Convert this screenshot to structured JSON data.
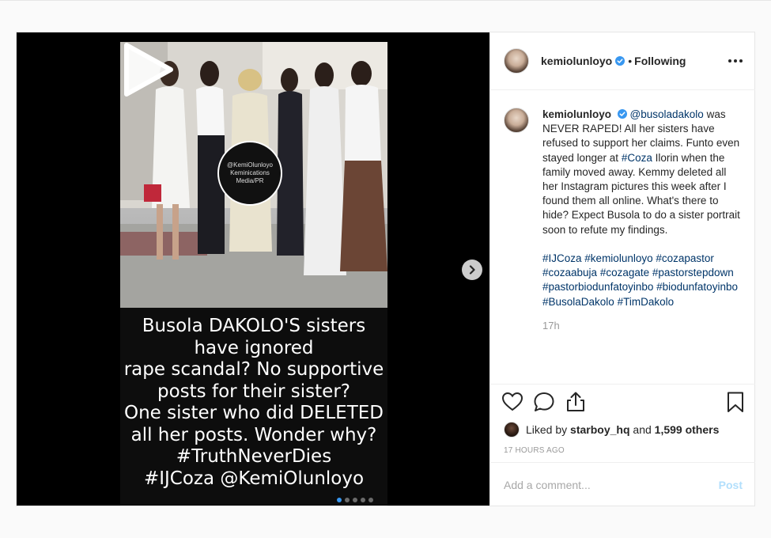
{
  "post": {
    "username": "kemiolunloyo",
    "follow_status": "Following",
    "bullet": "•",
    "image": {
      "watermark_lines": [
        "@KemiOlunloyo",
        "Keminications",
        "Media/PR"
      ],
      "caption_lines": [
        "Busola DAKOLO'S sisters",
        "have ignored",
        "rape scandal? No supportive",
        "posts for their sister?",
        "One sister who did DELETED",
        "all her posts. Wonder why?",
        "#TruthNeverDies",
        "#IJCoza @KemiOlunloyo"
      ],
      "carousel_count": 5,
      "carousel_active": 1
    },
    "caption": {
      "username": "kemiolunloyo",
      "mention": "@busoladakolo",
      "text1": " was NEVER RAPED! All her sisters have refused to support her claims. Funto even stayed longer at ",
      "tag_coza": "#Coza",
      "text2": " Ilorin when the family moved away. Kemmy deleted all her Instagram pictures this week after I found them all online. What's there to hide? Expect Busola to do a sister portrait soon to refute my findings.",
      "hashtags": [
        "#IJCoza",
        "#kemiolunloyo",
        "#cozapastor",
        "#cozaabuja",
        "#cozagate",
        "#pastorstepdown",
        "#pastorbiodunfatoyinbo",
        "#biodunfatoyinbo",
        "#BusolaDakolo",
        "#TimDakolo"
      ],
      "time": "17h"
    },
    "likes": {
      "liked_by_prefix": "Liked by ",
      "liked_by_user": "starboy_hq",
      "and": " and ",
      "others": "1,599 others"
    },
    "timestamp": "17 HOURS AGO",
    "comment_box": {
      "placeholder": "Add a comment...",
      "post_label": "Post"
    },
    "colors": {
      "accent_blue": "#3897f0",
      "link_blue": "#003569",
      "post_disabled": "#b2dffc"
    }
  }
}
